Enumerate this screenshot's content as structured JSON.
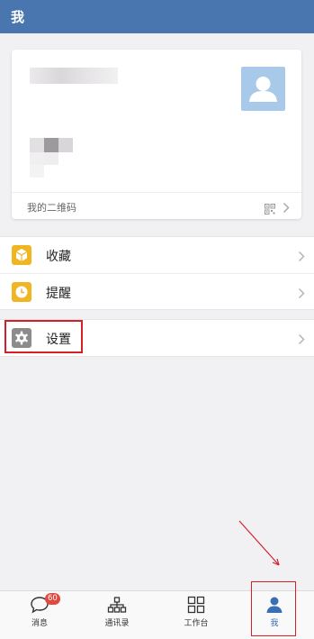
{
  "header": {
    "title": "我"
  },
  "profile": {
    "qr_label": "我的二维码"
  },
  "menu_group_1": [
    {
      "label": "收藏",
      "icon": "cube-icon",
      "icon_color": "#f0b523"
    },
    {
      "label": "提醒",
      "icon": "clock-icon",
      "icon_color": "#f0b523"
    }
  ],
  "menu_group_2": [
    {
      "label": "设置",
      "icon": "gear-icon",
      "icon_color": "#8c8c8c"
    }
  ],
  "tabbar": {
    "tabs": [
      {
        "label": "消息",
        "icon": "chat-bubble-icon",
        "badge": "60"
      },
      {
        "label": "通讯录",
        "icon": "org-chart-icon"
      },
      {
        "label": "工作台",
        "icon": "grid-icon"
      },
      {
        "label": "我",
        "icon": "person-icon",
        "active": true
      }
    ]
  },
  "colors": {
    "header_bg": "#4a76b0",
    "active_tab": "#3a6fb6",
    "badge": "#e2483d",
    "annotation": "#d42128"
  }
}
